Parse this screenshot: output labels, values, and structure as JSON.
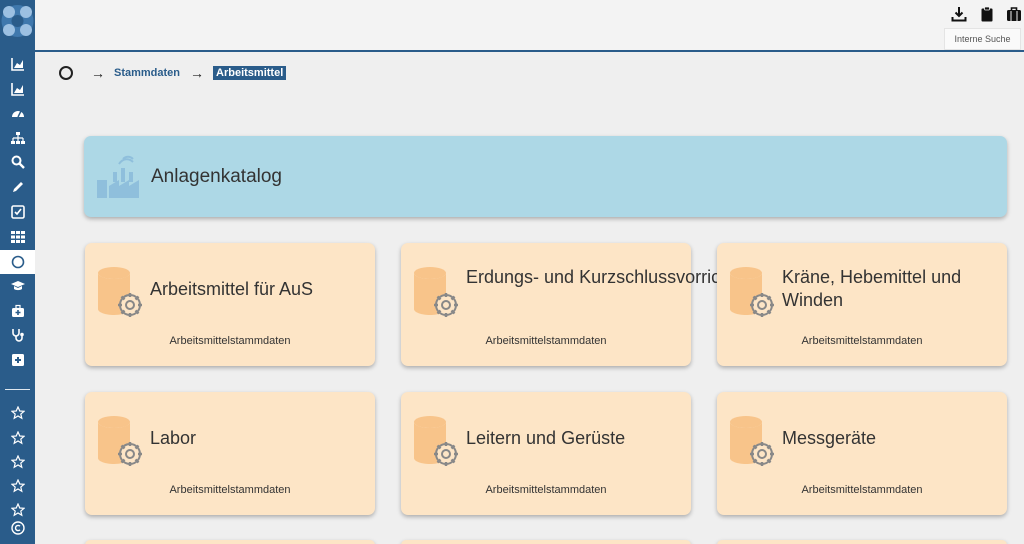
{
  "header": {
    "search_label": "Interne Suche"
  },
  "breadcrumb": {
    "link": "Stammdaten",
    "arrow": "→",
    "current": "Arbeitsmittel"
  },
  "catalog": {
    "title": "Anlagenkatalog"
  },
  "tiles": [
    {
      "title": "Arbeitsmittel für AuS",
      "sub": "Arbeitsmittelstammdaten"
    },
    {
      "title": "Erdungs- und Kurzschlussvorrichtungen",
      "sub": "Arbeitsmittelstammdaten"
    },
    {
      "title": "Kräne, Hebemittel und Winden",
      "sub": "Arbeitsmittelstammdaten"
    },
    {
      "title": "Labor",
      "sub": "Arbeitsmittelstammdaten"
    },
    {
      "title": "Leitern und Gerüste",
      "sub": "Arbeitsmittelstammdaten"
    },
    {
      "title": "Messgeräte",
      "sub": "Arbeitsmittelstammdaten"
    }
  ],
  "colors": {
    "primary": "#2a5c8a",
    "catalog_bg": "#add8e6",
    "tile_bg": "#fde5c6",
    "tile_icon": "#f8c48a",
    "page_bg": "#efefef"
  },
  "icons": {
    "sidebar": [
      "chart-icon",
      "chart-icon",
      "dashboard-icon",
      "sitemap-icon",
      "search-icon",
      "pencil-icon",
      "checkbox-icon",
      "grid-icon",
      "circle-icon",
      "graduation-icon",
      "medkit-icon",
      "stethoscope-icon",
      "plus-square-icon",
      "star-icon",
      "star-icon",
      "star-icon",
      "star-icon",
      "star-icon",
      "copyright-icon"
    ],
    "topbar": [
      "download-icon",
      "clipboard-icon",
      "briefcase-icon"
    ],
    "tiles": "database-gear-icon",
    "catalog": "factory-icon"
  }
}
